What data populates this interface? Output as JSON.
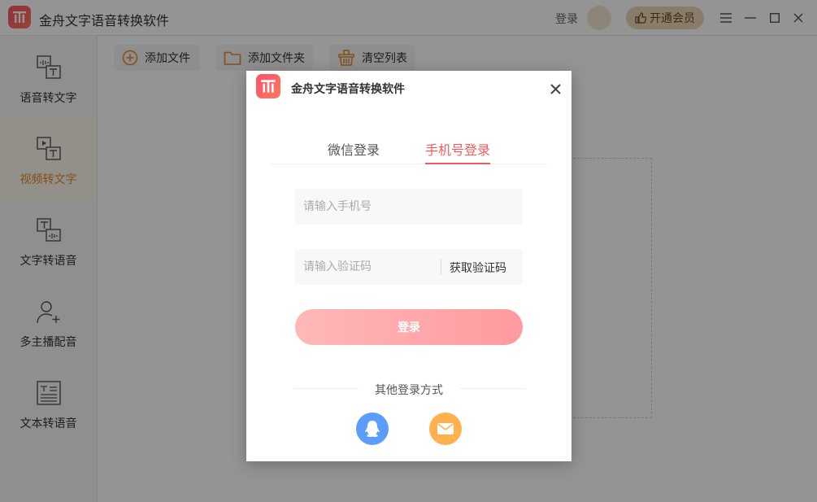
{
  "app": {
    "title": "金舟文字语音转换软件",
    "login_label": "登录",
    "vip_label": "开通会员"
  },
  "sidebar": {
    "items": [
      {
        "label": "语音转文字",
        "icon": "audio-to-text-icon"
      },
      {
        "label": "视频转文字",
        "icon": "video-to-text-icon",
        "active": true
      },
      {
        "label": "文字转语音",
        "icon": "text-to-audio-icon"
      },
      {
        "label": "多主播配音",
        "icon": "multi-speaker-icon"
      },
      {
        "label": "文本转语音",
        "icon": "document-text-icon"
      }
    ]
  },
  "toolbar": {
    "add_file": "添加文件",
    "add_folder": "添加文件夹",
    "clear_list": "清空列表"
  },
  "dialog": {
    "title": "金舟文字语音转换软件",
    "tabs": [
      {
        "label": "微信登录"
      },
      {
        "label": "手机号登录",
        "active": true
      }
    ],
    "phone_placeholder": "请输入手机号",
    "code_placeholder": "请输入验证码",
    "get_code": "获取验证码",
    "login_button": "登录",
    "other_methods": "其他登录方式"
  },
  "colors": {
    "accent": "#f25c5c",
    "sidebar_active": "#e08a2c",
    "qq": "#5b9dfc",
    "mail": "#ffb14d"
  }
}
